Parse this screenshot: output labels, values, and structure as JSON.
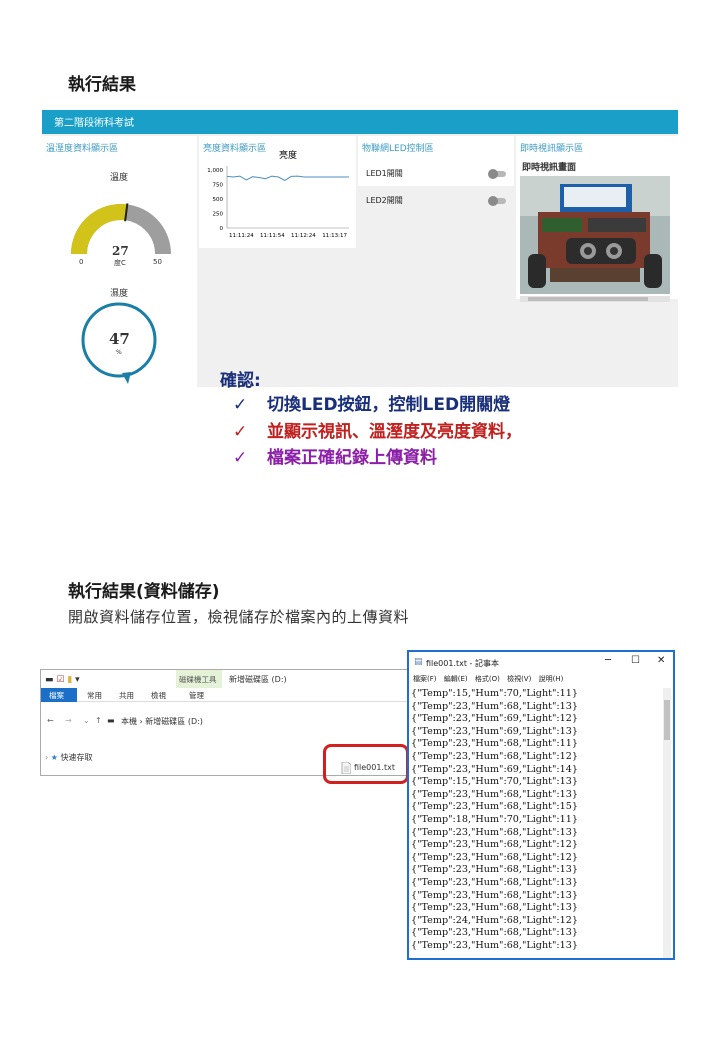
{
  "section1": {
    "heading": "執行結果"
  },
  "dashboard": {
    "title": "第二階段術科考試",
    "temp_panel": {
      "title": "溫溼度資料顯示區",
      "temp_label": "溫度",
      "temp_value": "27",
      "temp_min": "0",
      "temp_max": "50",
      "temp_unit": "度C",
      "temp_fraction": 0.54,
      "hum_label": "濕度",
      "hum_value": "47",
      "hum_unit": "%",
      "hum_fraction": 0.47
    },
    "light_panel": {
      "title": "亮度資料顯示區",
      "chart_title": "亮度"
    },
    "led_panel": {
      "title": "物聯網LED控制區",
      "led1": "LED1開關",
      "led2": "LED2開關"
    },
    "video_panel": {
      "title": "即時視訊顯示區",
      "subtitle": "即時視訊畫面"
    }
  },
  "chart_data": {
    "type": "line",
    "title": "亮度",
    "x_ticks": [
      "11:11:24",
      "11:11:54",
      "11:12:24",
      "11:13:17"
    ],
    "y_ticks": [
      "0",
      "250",
      "500",
      "750",
      "1,000"
    ],
    "ylim": [
      0,
      1000
    ],
    "series": [
      {
        "values": [
          890,
          880,
          895,
          830,
          885,
          870,
          850,
          895,
          880,
          820,
          890,
          895,
          880,
          880,
          880,
          880,
          880,
          880,
          880,
          880
        ]
      }
    ],
    "line_color": "#4a8ec4"
  },
  "confirm": {
    "title": "確認:",
    "mark": "✓",
    "items": [
      {
        "text": "切換LED按鈕，控制LED開關燈",
        "color": "#1a2f7a"
      },
      {
        "text": "並顯示視訊、溫溼度及亮度資料，",
        "color": "#c0211f"
      },
      {
        "text": "檔案正確紀錄上傳資料",
        "color": "#8b1fa8"
      }
    ]
  },
  "section2": {
    "heading": "執行結果(資料儲存)",
    "desc": "開啟資料儲存位置，檢視儲存於檔案內的上傳資料"
  },
  "explorer": {
    "tool_tab": "磁碟機工具",
    "window_title": "新增磁碟區 (D:)",
    "tabs": [
      "檔案",
      "常用",
      "共用",
      "檢視",
      "管理"
    ],
    "path": "本機 › 新增磁碟區 (D:)",
    "quick_access": "快速存取",
    "file_name": "file001.txt"
  },
  "notepad": {
    "title": "file001.txt - 記事本",
    "menu": [
      "檔案(F)",
      "編輯(E)",
      "格式(O)",
      "檢視(V)",
      "說明(H)"
    ],
    "lines": [
      "{\"Temp\":15,\"Hum\":70,\"Light\":11}",
      "{\"Temp\":23,\"Hum\":68,\"Light\":13}",
      "{\"Temp\":23,\"Hum\":69,\"Light\":12}",
      "{\"Temp\":23,\"Hum\":69,\"Light\":13}",
      "{\"Temp\":23,\"Hum\":68,\"Light\":11}",
      "{\"Temp\":23,\"Hum\":68,\"Light\":12}",
      "{\"Temp\":23,\"Hum\":69,\"Light\":14}",
      "{\"Temp\":15,\"Hum\":70,\"Light\":13}",
      "{\"Temp\":23,\"Hum\":68,\"Light\":13}",
      "{\"Temp\":23,\"Hum\":68,\"Light\":15}",
      "{\"Temp\":18,\"Hum\":70,\"Light\":11}",
      "{\"Temp\":23,\"Hum\":68,\"Light\":13}",
      "{\"Temp\":23,\"Hum\":68,\"Light\":12}",
      "{\"Temp\":23,\"Hum\":68,\"Light\":12}",
      "{\"Temp\":23,\"Hum\":68,\"Light\":13}",
      "{\"Temp\":23,\"Hum\":68,\"Light\":13}",
      "{\"Temp\":23,\"Hum\":68,\"Light\":13}",
      "{\"Temp\":23,\"Hum\":68,\"Light\":13}",
      "{\"Temp\":24,\"Hum\":68,\"Light\":12}",
      "{\"Temp\":23,\"Hum\":68,\"Light\":13}",
      "{\"Temp\":23,\"Hum\":68,\"Light\":13}"
    ]
  }
}
